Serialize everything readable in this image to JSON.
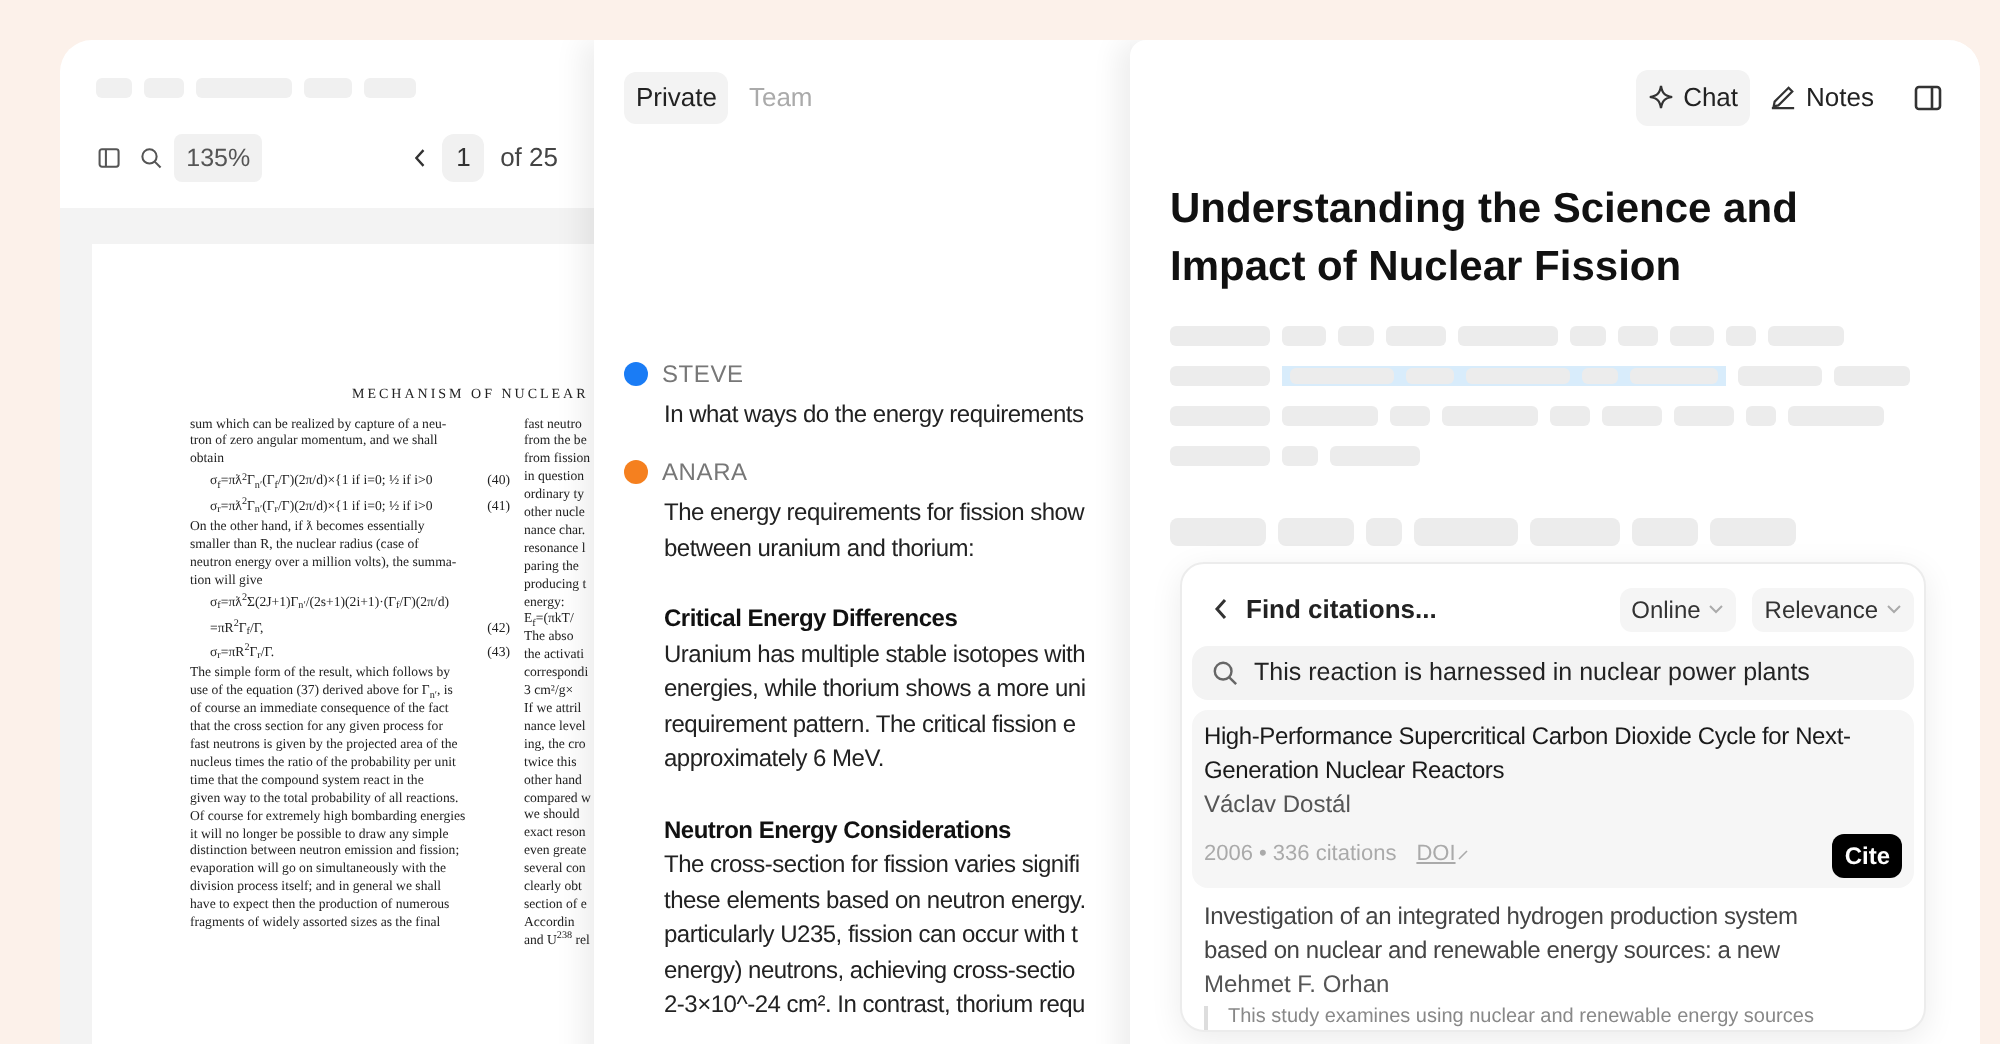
{
  "viewer": {
    "zoom": "135%",
    "page_number": "1",
    "page_total": "of 25",
    "page": {
      "running_head": "MECHANISM OF NUCLEAR",
      "left_column": [
        {
          "kind": "text",
          "text": "sum which can be realized by capture of a neu-"
        },
        {
          "kind": "text",
          "text": "tron of zero angular momentum, and we shall"
        },
        {
          "kind": "text",
          "text": "obtain"
        },
        {
          "kind": "equation",
          "text": "σ$_{f}$=πƛ$^{2}$Γ$_{n′}$(Γ$_{f}$/Γ)(2π/d)×{1 if i=0; ½ if i>0",
          "number": "(40)"
        },
        {
          "kind": "equation",
          "text": "σ$_{r}$=πƛ$^{2}$Γ$_{n′}$(Γ$_{r}$/Γ)(2π/d)×{1 if i=0; ½ if i>0",
          "number": "(41)"
        },
        {
          "kind": "text",
          "text": "On the other hand, if ƛ becomes essentially"
        },
        {
          "kind": "text",
          "text": "smaller than R, the nuclear radius (case of"
        },
        {
          "kind": "text",
          "text": "neutron energy over a million volts), the summa-"
        },
        {
          "kind": "text",
          "text": "tion will give"
        },
        {
          "kind": "equation",
          "text": "σ$_{f}$=πƛ$^{2}$Σ(2J+1)Γ$_{n′}$/(2s+1)(2i+1)·(Γ$_{f}$/Γ)(2π/d)"
        },
        {
          "kind": "equation",
          "text": "=πR$^{2}$Γ$_{f}$/Γ,",
          "number": "(42)"
        },
        {
          "kind": "equation",
          "text": "σ$_{r}$=πR$^{2}$Γ$_{r}$/Γ.",
          "number": "(43)"
        },
        {
          "kind": "text",
          "text": "The simple form of the result, which follows by"
        },
        {
          "kind": "text",
          "text": "use of the equation (37) derived above for Γ$_{n′}$, is"
        },
        {
          "kind": "text",
          "text": "of course an immediate consequence of the fact"
        },
        {
          "kind": "text",
          "text": "that the cross section for any given process for"
        },
        {
          "kind": "text",
          "text": "fast neutrons is given by the projected area of the"
        },
        {
          "kind": "text",
          "text": "nucleus times the ratio of the probability per unit"
        },
        {
          "kind": "text",
          "text": "time that the compound system react in the"
        },
        {
          "kind": "text",
          "text": "given way to the total probability of all reactions."
        },
        {
          "kind": "text",
          "text": "Of course for extremely high bombarding energies"
        },
        {
          "kind": "text",
          "text": "it will no longer be possible to draw any simple"
        },
        {
          "kind": "text",
          "text": "distinction between neutron emission and fission;"
        },
        {
          "kind": "text",
          "text": "evaporation will go on simultaneously with the"
        },
        {
          "kind": "text",
          "text": "division process itself; and in general we shall"
        },
        {
          "kind": "text",
          "text": "have to expect then the production of numerous"
        },
        {
          "kind": "text",
          "text": "fragments of widely assorted sizes as the final"
        }
      ],
      "right_column": [
        "fast neutro",
        "from the be",
        "from fission",
        "in question",
        "ordinary ty",
        "other nucle",
        "nance char.",
        "resonance l",
        "paring the",
        "producing t",
        "energy:",
        "E$_{f}$=(πkT/",
        "The abso",
        "the activati",
        "correspondi",
        "3 cm²/g×",
        "If we attril",
        "nance level",
        "ing, the cro",
        "twice this",
        "other hand",
        "compared w",
        "we should",
        "exact reson",
        "even greate",
        "several con",
        "clearly obt",
        "section of e",
        "Accordin",
        "and U$^{238}$ rel"
      ]
    }
  },
  "chat": {
    "tabs": [
      {
        "label": "Private",
        "selected": true
      },
      {
        "label": "Team",
        "selected": false
      }
    ],
    "messages": [
      {
        "author": "STEVE",
        "color": "#1a7cf5",
        "blocks": [
          {
            "kind": "paragraph",
            "lines": [
              "In what ways do the energy requirements"
            ]
          }
        ]
      },
      {
        "author": "ANARA",
        "color": "#f5801f",
        "blocks": [
          {
            "kind": "paragraph",
            "lines": [
              "The energy requirements for fission show",
              "between uranium and thorium:"
            ]
          },
          {
            "kind": "heading",
            "lines": [
              "Critical Energy Differences"
            ]
          },
          {
            "kind": "paragraph",
            "lines": [
              "Uranium has multiple stable isotopes with",
              "energies, while thorium shows a more uni",
              "requirement pattern. The critical fission e",
              "approximately 6 MeV."
            ]
          },
          {
            "kind": "heading",
            "lines": [
              "Neutron Energy Considerations"
            ]
          },
          {
            "kind": "paragraph",
            "lines": [
              "The cross-section for fission varies signifi",
              "these elements based on neutron energy.",
              "particularly U235, fission can occur with t",
              "energy) neutrons, achieving cross-sectio",
              "2-3×10^-24 cm². In contrast, thorium requ"
            ]
          }
        ]
      }
    ]
  },
  "notes": {
    "modes": [
      {
        "label": "Chat",
        "selected": true
      },
      {
        "label": "Notes",
        "selected": false
      }
    ],
    "title": "Understanding the Science and Impact of Nuclear Fission",
    "citation_finder": {
      "title": "Find citations...",
      "filters": [
        "Online",
        "Relevance"
      ],
      "query": "This reaction is harnessed in nuclear power plants",
      "results": [
        {
          "title": "High-Performance Supercritical Carbon Dioxide Cycle for Next-Generation Nuclear Reactors",
          "author": "Václav Dostál",
          "selected": true,
          "meta": "2006 • 336 citations",
          "link": "DOI",
          "action": "Cite"
        },
        {
          "title": "Investigation of an integrated hydrogen production system based on nuclear and renewable energy sources: a new",
          "author": "Mehmet F. Orhan",
          "selected": false,
          "snippet": "This study examines using nuclear and renewable energy sources"
        }
      ]
    }
  }
}
